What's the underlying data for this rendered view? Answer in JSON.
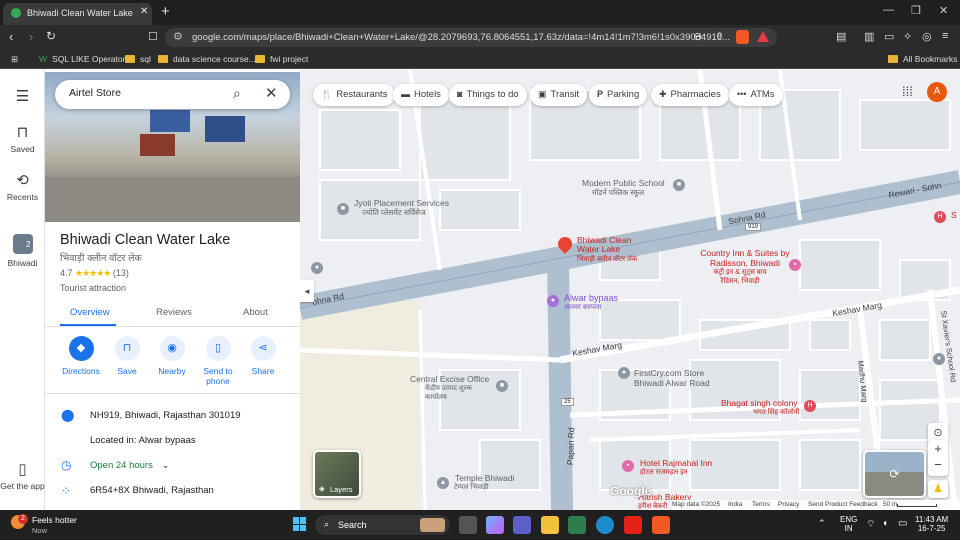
{
  "browser": {
    "tab_title": "Bhiwadi Clean Water Lake - Goo",
    "url": "google.com/maps/place/Bhiwadi+Clean+Water+Lake/@28.2079693,76.8064551,17.63z/data=!4m14!1m7!3m6!1s0x390d4910...",
    "bookmarks": [
      "SQL LIKE Operator",
      "sql",
      "data science course...",
      "fwi project"
    ],
    "all_bookmarks": "All Bookmarks"
  },
  "rail": {
    "saved": "Saved",
    "recents": "Recents",
    "recent_place": "Bhiwadi",
    "get_app": "Get the app"
  },
  "search": {
    "value": "Airtel Store"
  },
  "place": {
    "name": "Bhiwadi Clean Water Lake",
    "name_hindi": "भिवाड़ी क्लीन वॉटर लेक",
    "rating": "4.7",
    "stars": "★★★★★",
    "reviews": "(13)",
    "type": "Tourist attraction",
    "tabs": [
      "Overview",
      "Reviews",
      "About"
    ],
    "actions": [
      "Directions",
      "Save",
      "Nearby",
      "Send to phone",
      "Share"
    ],
    "address": "NH919, Bhiwadi, Rajasthan 301019",
    "located_in": "Located in: Alwar bypaas",
    "hours": "Open 24 hours",
    "plus_code": "6R54+8X Bhiwadi, Rajasthan"
  },
  "chips": [
    "Restaurants",
    "Hotels",
    "Things to do",
    "Transit",
    "Parking",
    "Pharmacies",
    "ATMs"
  ],
  "avatar": "A",
  "map": {
    "roads": [
      "Sohna Rd",
      "Sohna Rd",
      "ohna Rd",
      "Rewari - Sohn",
      "Keshav Marg",
      "Keshav Marg",
      "Papari Rd",
      "Madhu Marg",
      "St Xavier's School Rd"
    ],
    "route_badges": [
      "919",
      "25"
    ],
    "pois": {
      "modern_school": "Modern Public School",
      "modern_school_hi": "मॉडर्न पब्लिक स्कूल",
      "jyoti": "Jyoti Placement Services",
      "jyoti_hi": "ज्योति प्लेसमेंट सर्विसेज",
      "lake": "Bhiwadi Clean Water Lake",
      "lake_hi": "भिवाड़ी क्लीन वॉटर लेक",
      "country_inn": "Country Inn & Suites by Radisson, Bhiwadi",
      "country_inn_hi": "कंट्री इन & सूट्स बाय रैडिसन, भिवाड़ी",
      "alwar": "Alwar bypaas",
      "alwar_hi": "अलवर बयपास",
      "firstcry": "FirstCry.com Store Bhiwadi Alwar Road",
      "central_excise": "Central Excise Office",
      "central_excise_hi": "केंद्रीय उत्पाद शुल्क कार्यालय",
      "bhagat": "Bhagat singh colony",
      "bhagat_hi": "भगत सिंह कॉलोनी",
      "temple": "Temple Bhiwadi",
      "temple_hi": "टेम्पल भिवाड़ी",
      "rajmahal": "Hotel Rajmahal Inn",
      "rajmahal_hi": "होटल राजमहल इन",
      "harish": "Harish Bakery",
      "harish_hi": "हरीश बेकरी",
      "s_label": "S"
    },
    "layers": "Layers",
    "footer": [
      "Map data ©2025",
      "India",
      "Terms",
      "Privacy",
      "Send Product Feedback",
      "50 m"
    ]
  },
  "taskbar": {
    "weather": "Feels hotter",
    "weather_sub": "Now",
    "badge": "2",
    "search": "Search",
    "lang1": "ENG",
    "lang2": "IN",
    "time": "11:43 AM",
    "date": "16-7-25"
  }
}
